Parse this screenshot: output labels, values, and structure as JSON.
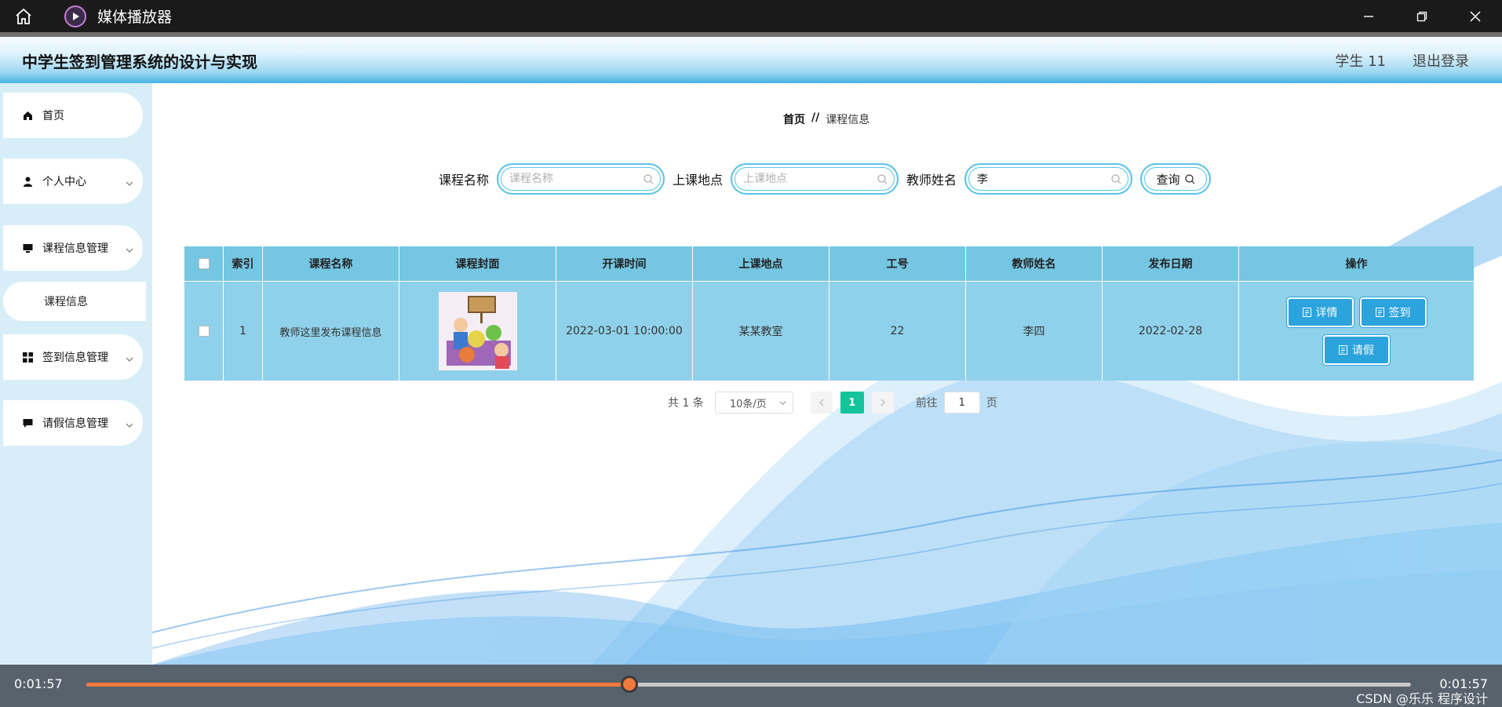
{
  "window": {
    "title": "媒体播放器"
  },
  "app": {
    "title": "中学生签到管理系统的设计与实现",
    "user": "学生 11",
    "logout": "退出登录"
  },
  "sidebar": {
    "items": [
      {
        "label": "首页",
        "icon": "home-icon"
      },
      {
        "label": "个人中心",
        "icon": "user-icon"
      },
      {
        "label": "课程信息管理",
        "icon": "monitor-icon"
      },
      {
        "label": "签到信息管理",
        "icon": "grid-icon"
      },
      {
        "label": "请假信息管理",
        "icon": "message-icon"
      }
    ],
    "sub_item": "课程信息"
  },
  "breadcrumb": {
    "home": "首页",
    "sep": "//",
    "current": "课程信息"
  },
  "search": {
    "course_label": "课程名称",
    "course_placeholder": "课程名称",
    "place_label": "上课地点",
    "place_placeholder": "上课地点",
    "teacher_label": "教师姓名",
    "teacher_value": "李",
    "query_label": "查询"
  },
  "table": {
    "headers": [
      "索引",
      "课程名称",
      "课程封面",
      "开课时间",
      "上课地点",
      "工号",
      "教师姓名",
      "发布日期",
      "操作"
    ],
    "rows": [
      {
        "index": "1",
        "name": "教师这里发布课程信息",
        "start": "2022-03-01 10:00:00",
        "place": "某某教室",
        "job_no": "22",
        "teacher": "李四",
        "date": "2022-02-28",
        "actions": [
          "详情",
          "签到",
          "请假"
        ]
      }
    ]
  },
  "pagination": {
    "total": "共 1 条",
    "page_size": "10条/页",
    "current": "1",
    "goto_label": "前往",
    "goto_value": "1",
    "page_suffix": "页"
  },
  "player": {
    "elapsed": "0:01:57",
    "duration": "0:01:57",
    "progress": 0.41,
    "watermark": "CSDN @乐乐 程序设计"
  },
  "colors": {
    "header_accent": "#48b4e6",
    "table_header": "#75c6e2",
    "table_row": "#8fd1ea",
    "action_button": "#2ba3dc",
    "active_page": "#13c49a",
    "progress": "#f07a3e"
  }
}
